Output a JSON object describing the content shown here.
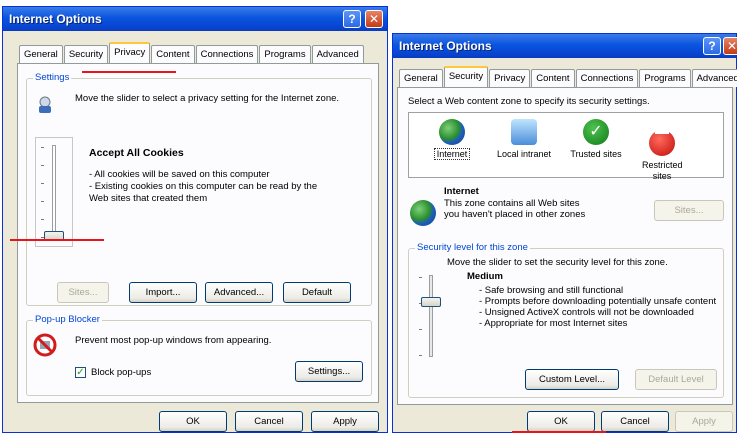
{
  "left_dialog": {
    "title": "Internet Options",
    "help_glyph": "?",
    "close_glyph": "✕",
    "tabs": [
      "General",
      "Security",
      "Privacy",
      "Content",
      "Connections",
      "Programs",
      "Advanced"
    ],
    "active_tab": "Privacy",
    "settings": {
      "group_label": "Settings",
      "instruction": "Move the slider to select a privacy setting for the Internet zone.",
      "level_title": "Accept All Cookies",
      "level_bullets": [
        "- All cookies will be saved on this computer",
        "- Existing cookies on this computer can be read by the Web sites that created them"
      ],
      "buttons": {
        "sites": "Sites...",
        "import": "Import...",
        "advanced": "Advanced...",
        "default": "Default"
      }
    },
    "popup": {
      "group_label": "Pop-up Blocker",
      "description": "Prevent most pop-up windows from appearing.",
      "checkbox_label": "Block pop-ups",
      "checkbox_checked": true,
      "settings_button": "Settings..."
    },
    "footer": {
      "ok": "OK",
      "cancel": "Cancel",
      "apply": "Apply"
    }
  },
  "right_dialog": {
    "title": "Internet Options",
    "help_glyph": "?",
    "close_glyph": "✕",
    "tabs": [
      "General",
      "Security",
      "Privacy",
      "Content",
      "Connections",
      "Programs",
      "Advanced"
    ],
    "active_tab": "Security",
    "zone_prompt": "Select a Web content zone to specify its security settings.",
    "zones": [
      {
        "label": "Internet",
        "icon": "globe-icon"
      },
      {
        "label": "Local intranet",
        "icon": "intranet-icon"
      },
      {
        "label": "Trusted sites",
        "icon": "checkmark-icon"
      },
      {
        "label": "Restricted sites",
        "icon": "restricted-icon"
      }
    ],
    "zone_info": {
      "title": "Internet",
      "description": "This zone contains all Web sites you haven't placed in other zones",
      "sites_button": "Sites..."
    },
    "security_level": {
      "group_label": "Security level for this zone",
      "instruction": "Move the slider to set the security level for this zone.",
      "level_title": "Medium",
      "bullets": [
        "- Safe browsing and still functional",
        "- Prompts before downloading potentially unsafe content",
        "- Unsigned ActiveX controls will not be downloaded",
        "- Appropriate for most Internet sites"
      ],
      "custom_level_button": "Custom Level...",
      "default_level_button": "Default Level"
    },
    "footer": {
      "ok": "OK",
      "cancel": "Cancel",
      "apply": "Apply"
    }
  },
  "colors": {
    "highlight_line": "#e8141b",
    "title_bar": "#0a54e0",
    "group_label": "#0046d5"
  }
}
